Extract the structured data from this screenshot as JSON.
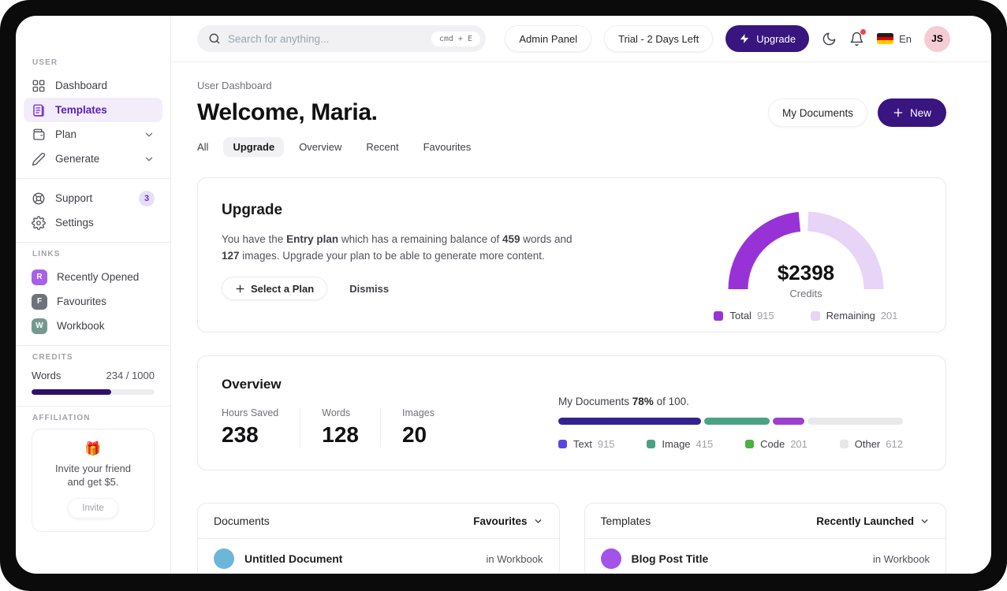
{
  "colors": {
    "primary_button": "#38157f",
    "credits_fill": "#2e1168",
    "sidebar_active_text": "#5b21b6",
    "notification_dot": "#ef4444",
    "avatar_bg": "#f6ccd4",
    "avatar_text": "#93404f",
    "flag_stripes": [
      "#1f1f1f",
      "#dd0000",
      "#ffce00"
    ]
  },
  "topbar": {
    "search": {
      "placeholder": "Search for anything...",
      "shortcut": "cmd + E"
    },
    "admin_panel": "Admin Panel",
    "trial": "Trial - 2 Days Left",
    "upgrade": "Upgrade",
    "language": "En",
    "avatar_initials": "JS"
  },
  "sidebar": {
    "user_label": "USER",
    "items": [
      {
        "label": "Dashboard"
      },
      {
        "label": "Templates"
      },
      {
        "label": "Plan"
      },
      {
        "label": "Generate"
      }
    ],
    "support": {
      "label": "Support",
      "badge": "3"
    },
    "settings_label": "Settings",
    "links_label": "LINKS",
    "links": [
      {
        "initial": "R",
        "label": "Recently Opened",
        "color": "#a661e8"
      },
      {
        "initial": "F",
        "label": "Favourites",
        "color": "#6d727d"
      },
      {
        "initial": "W",
        "label": "Workbook",
        "color": "#76998f"
      }
    ],
    "credits_label": "CREDITS",
    "credits": {
      "label": "Words",
      "value": "234 / 1000",
      "fill_percent": 65
    },
    "affiliation_label": "AFFILIATION",
    "affiliation": {
      "emoji": "🎁",
      "text_line1": "Invite your friend",
      "text_line2": "and get $5.",
      "button": "Invite"
    }
  },
  "header": {
    "breadcrumb": "User Dashboard",
    "title": "Welcome, Maria.",
    "my_documents": "My Documents",
    "new_button": "New"
  },
  "tabs": [
    {
      "label": "All"
    },
    {
      "label": "Upgrade",
      "active": true
    },
    {
      "label": "Overview"
    },
    {
      "label": "Recent"
    },
    {
      "label": "Favourites"
    }
  ],
  "upgrade_card": {
    "title": "Upgrade",
    "text": {
      "p1": "You have the ",
      "b1": "Entry plan",
      "p2": " which has a remaining balance of ",
      "b2": "459",
      "p3": " words and ",
      "b3": "127",
      "p4": " images. Upgrade your plan to be able to generate more content."
    },
    "select_plan": "Select a Plan",
    "dismiss": "Dismiss"
  },
  "chart_data": [
    {
      "id": "credits-gauge",
      "type": "pie",
      "subtype": "half-donut-gauge",
      "center_value": "$2398",
      "center_label": "Credits",
      "legend_position": "bottom",
      "segments": [
        {
          "label": "Total",
          "value": 915,
          "color": "#9733d6",
          "arc_fraction": 0.47
        },
        {
          "label": "Remaining",
          "value": 201,
          "color": "#e8d4f6",
          "arc_fraction": 0.49
        }
      ]
    },
    {
      "id": "documents-usage",
      "type": "bar",
      "subtype": "stacked-progress",
      "label_prefix": "My Documents ",
      "label_percent": "78%",
      "label_suffix": " of 100.",
      "track_color": "#e9e9ed",
      "segments": [
        {
          "label": "Text",
          "value": 915,
          "bar_color": "#34238f",
          "legend_color": "#5a46df"
        },
        {
          "label": "Image",
          "value": 415,
          "bar_color": "#49a283",
          "legend_color": "#49a283"
        },
        {
          "label": "Code",
          "value": 201,
          "bar_color": "#9c3fd0",
          "legend_color": "#4cb043"
        },
        {
          "label": "Other",
          "value": 612,
          "bar_color": "#e9e9ed",
          "legend_color": "#e7e7ea"
        }
      ]
    }
  ],
  "overview_card": {
    "title": "Overview",
    "stats": [
      {
        "label": "Hours Saved",
        "value": "238"
      },
      {
        "label": "Words",
        "value": "128"
      },
      {
        "label": "Images",
        "value": "20"
      }
    ]
  },
  "documents_card": {
    "title": "Documents",
    "filter": "Favourites",
    "rows": [
      {
        "name": "Untitled Document",
        "location": "in Workbook",
        "avatar_color": "#6cb7d9"
      }
    ]
  },
  "templates_card": {
    "title": "Templates",
    "filter": "Recently Launched",
    "rows": [
      {
        "name": "Blog Post Title",
        "location": "in Workbook",
        "avatar_color": "#a254e8"
      }
    ]
  }
}
